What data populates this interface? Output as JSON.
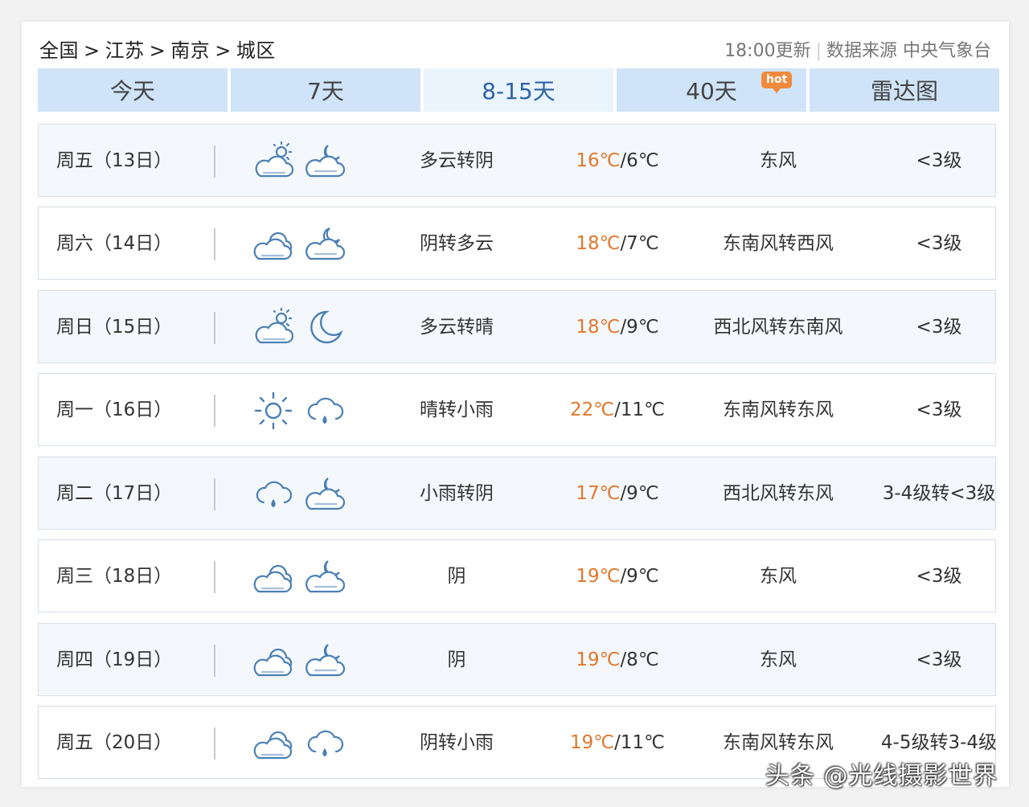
{
  "breadcrumb": {
    "items": [
      "全国",
      "江苏",
      "南京",
      "城区"
    ],
    "separator": ">"
  },
  "header": {
    "updated": "18:00更新",
    "source_label": "数据来源 中央气象台"
  },
  "tabs": [
    {
      "label": "今天"
    },
    {
      "label": "7天"
    },
    {
      "label": "8-15天",
      "active": true
    },
    {
      "label": "40天",
      "badge": "hot"
    },
    {
      "label": "雷达图"
    }
  ],
  "colors": {
    "tab_bg": "#cfe4f8",
    "tab_active_bg": "#eaf4fd",
    "tab_active_text": "#2d63a8",
    "high_temp": "#e2772b",
    "icon_stroke": "#4a7fb5",
    "hot_badge": "#f08a3c"
  },
  "forecast": [
    {
      "day": "周五（13日）",
      "day_icon": "partly-cloudy-day-icon",
      "night_icon": "partly-cloudy-night-icon",
      "desc": "多云转阴",
      "high": "16℃",
      "low": "/6℃",
      "wind": "东风",
      "level": "<3级"
    },
    {
      "day": "周六（14日）",
      "day_icon": "cloudy-icon",
      "night_icon": "cloudy-night-icon",
      "desc": "阴转多云",
      "high": "18℃",
      "low": "/7℃",
      "wind": "东南风转西风",
      "level": "<3级"
    },
    {
      "day": "周日（15日）",
      "day_icon": "partly-cloudy-day-icon",
      "night_icon": "clear-night-moon-icon",
      "desc": "多云转晴",
      "high": "18℃",
      "low": "/9℃",
      "wind": "西北风转东南风",
      "level": "<3级"
    },
    {
      "day": "周一（16日）",
      "day_icon": "sun-icon",
      "night_icon": "light-rain-icon",
      "desc": "晴转小雨",
      "high": "22℃",
      "low": "/11℃",
      "wind": "东南风转东风",
      "level": "<3级"
    },
    {
      "day": "周二（17日）",
      "day_icon": "light-rain-icon",
      "night_icon": "partly-cloudy-night-icon",
      "desc": "小雨转阴",
      "high": "17℃",
      "low": "/9℃",
      "wind": "西北风转东风",
      "level": "3-4级转<3级"
    },
    {
      "day": "周三（18日）",
      "day_icon": "cloudy-icon",
      "night_icon": "partly-cloudy-night-icon",
      "desc": "阴",
      "high": "19℃",
      "low": "/9℃",
      "wind": "东风",
      "level": "<3级"
    },
    {
      "day": "周四（19日）",
      "day_icon": "cloudy-icon",
      "night_icon": "partly-cloudy-night-icon",
      "desc": "阴",
      "high": "19℃",
      "low": "/8℃",
      "wind": "东风",
      "level": "<3级"
    },
    {
      "day": "周五（20日）",
      "day_icon": "cloudy-icon",
      "night_icon": "light-rain-icon",
      "desc": "阴转小雨",
      "high": "19℃",
      "low": "/11℃",
      "wind": "东南风转东风",
      "level": "4-5级转3-4级"
    }
  ],
  "watermark": "头条 @光线摄影世界"
}
